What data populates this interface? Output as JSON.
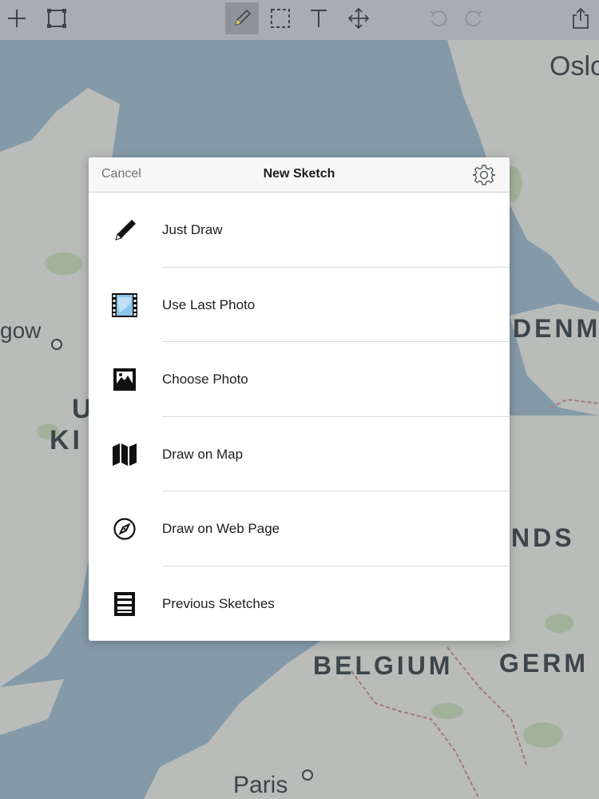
{
  "toolbar": {
    "tools": [
      {
        "id": "add",
        "icon": "plus-icon"
      },
      {
        "id": "frame",
        "icon": "frame-icon"
      },
      {
        "id": "pencil",
        "icon": "pencil-icon",
        "active": true
      },
      {
        "id": "select",
        "icon": "selection-icon"
      },
      {
        "id": "text",
        "icon": "text-icon"
      },
      {
        "id": "move",
        "icon": "move-icon"
      },
      {
        "id": "undo",
        "icon": "undo-icon",
        "disabled": true
      },
      {
        "id": "redo",
        "icon": "redo-icon",
        "disabled": true
      },
      {
        "id": "share",
        "icon": "share-icon"
      }
    ]
  },
  "map": {
    "labels": {
      "oslo": "Oslo",
      "glasgow": "gow",
      "uk_line1": "U",
      "uk_line2": "KI",
      "denmark": "DENM",
      "netherlands": "NDS",
      "belgium": "BELGIUM",
      "germany": "GERM",
      "paris": "Paris"
    }
  },
  "sheet": {
    "cancel_label": "Cancel",
    "title": "New Sketch",
    "settings_icon": "gear-icon",
    "items": [
      {
        "label": "Just Draw",
        "icon": "pen-icon"
      },
      {
        "label": "Use Last Photo",
        "icon": "film-photo-icon"
      },
      {
        "label": "Choose Photo",
        "icon": "image-icon"
      },
      {
        "label": "Draw on Map",
        "icon": "map-icon"
      },
      {
        "label": "Draw on Web Page",
        "icon": "compass-icon"
      },
      {
        "label": "Previous Sketches",
        "icon": "cabinet-icon"
      }
    ]
  },
  "colors": {
    "water": "#9db8c8",
    "land": "#e7e6df",
    "park": "#c6d9b5",
    "border": "#c98a8a"
  }
}
